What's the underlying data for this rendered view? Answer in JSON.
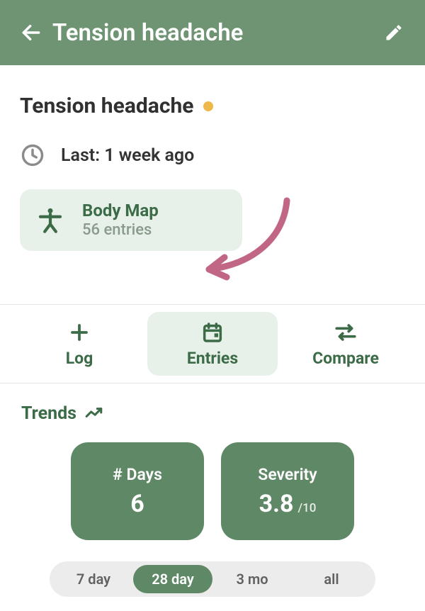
{
  "colors": {
    "headerBg": "#6e9473",
    "accent": "#3c6b47",
    "cardBg": "#5f8866",
    "dot": "#eeb84b",
    "arrow": "#c26685"
  },
  "header": {
    "title": "Tension headache"
  },
  "summary": {
    "title": "Tension headache",
    "lastLabel": "Last: 1 week ago"
  },
  "bodyMap": {
    "title": "Body Map",
    "subtitle": "56 entries"
  },
  "tabs": {
    "log": "Log",
    "entries": "Entries",
    "compare": "Compare",
    "activeIndex": 1
  },
  "trends": {
    "heading": "Trends",
    "cards": [
      {
        "title": "# Days",
        "value": "6",
        "suffix": ""
      },
      {
        "title": "Severity",
        "value": "3.8",
        "suffix": "/10"
      }
    ],
    "ranges": [
      "7 day",
      "28 day",
      "3 mo",
      "all"
    ],
    "rangeActiveIndex": 1
  }
}
